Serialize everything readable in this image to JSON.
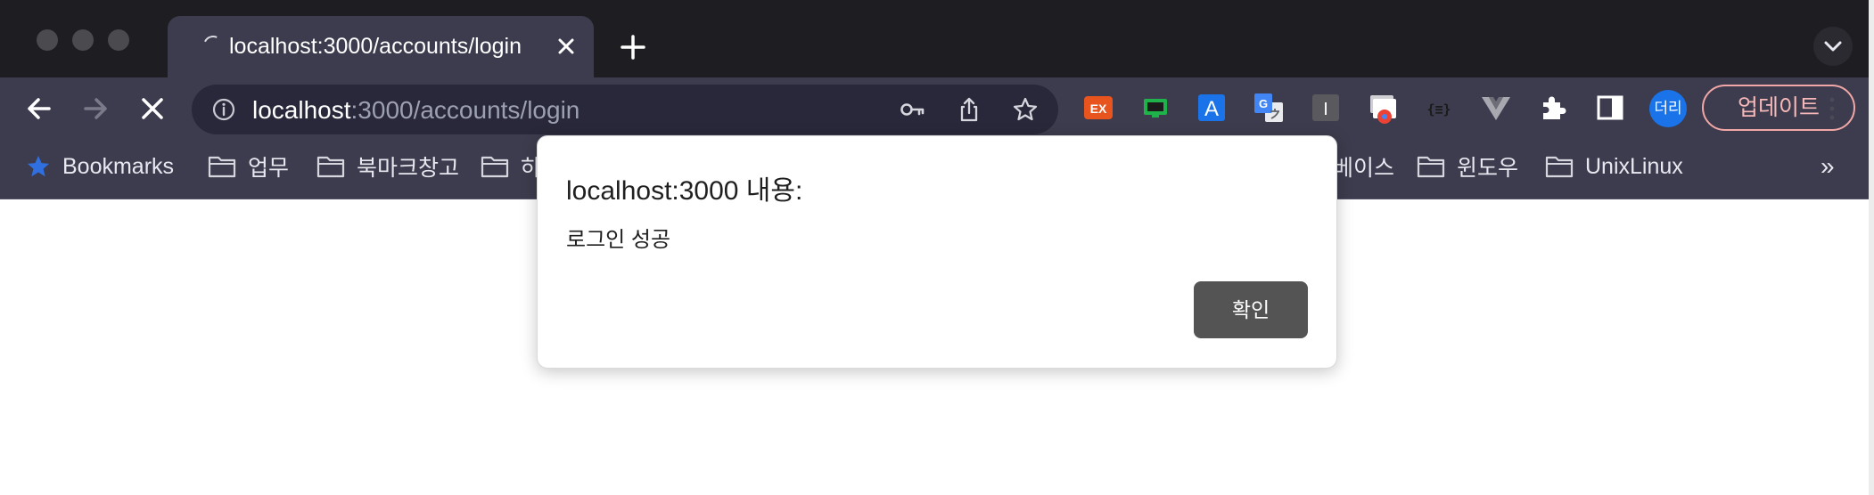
{
  "browser": {
    "tab": {
      "title": "localhost:3000/accounts/login"
    },
    "omnibox": {
      "host": "localhost",
      "rest": ":3000/accounts/login"
    },
    "profile_avatar": "더리",
    "update_button": "업데이트",
    "bookmarks_overflow": "»",
    "accent_colors": {
      "tab_bar": "#1e1e22",
      "toolbar": "#3c3c4e",
      "update_border": "#f2a7a7",
      "avatar": "#1a73e8"
    }
  },
  "bookmarks": [
    {
      "label": "Bookmarks",
      "icon": "star-icon"
    },
    {
      "label": "업무",
      "icon": "folder-icon"
    },
    {
      "label": "북마크창고",
      "icon": "folder-icon"
    },
    {
      "label": "하",
      "icon": "folder-icon"
    },
    {
      "label": "베이스",
      "icon": "folder-icon"
    },
    {
      "label": "윈도우",
      "icon": "folder-icon"
    },
    {
      "label": "UnixLinux",
      "icon": "folder-icon"
    }
  ],
  "extensions": {
    "ex_badge": "EX",
    "a_badge": "A",
    "i_badge": "I",
    "json_badge": "{≡}"
  },
  "dialog": {
    "title": "localhost:3000 내용:",
    "message": "로그인 성공",
    "ok_label": "확인"
  }
}
